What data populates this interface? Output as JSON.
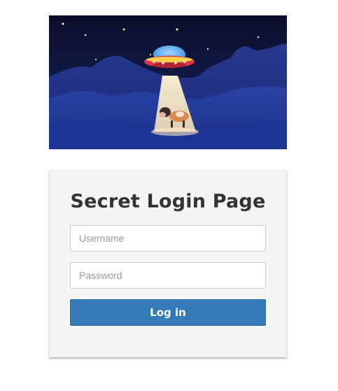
{
  "hero": {
    "image_subject": "ufo-abducting-cow-illustration"
  },
  "login": {
    "title": "Secret Login Page",
    "username_placeholder": "Username",
    "username_value": "",
    "password_placeholder": "Password",
    "password_value": "",
    "submit_label": "Log in"
  },
  "colors": {
    "button": "#337ab7",
    "card_background": "#f5f5f5",
    "title_text": "#333333"
  }
}
